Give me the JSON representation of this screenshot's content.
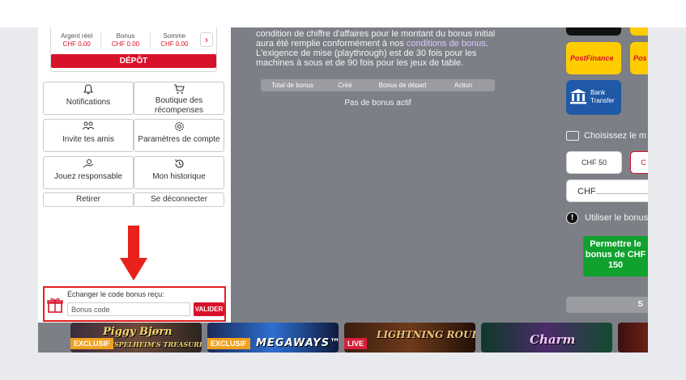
{
  "balance": {
    "cols": [
      {
        "label": "Argent réel",
        "value": "CHF 0.00"
      },
      {
        "label": "Bonus",
        "value": "CHF 0.00"
      },
      {
        "label": "Somme",
        "value": "CHF 0.00"
      }
    ],
    "arrow": "›",
    "deposit_label": "DÉPÔT"
  },
  "menu": {
    "notifications": "Notifications",
    "shop": "Boutique des récompenses",
    "invite": "Invite tes amis",
    "settings": "Paramètres de compte",
    "responsible": "Jouez responsable",
    "history": "Mon historique",
    "withdraw": "Retirer",
    "logout": "Se déconnecter"
  },
  "bonus_code": {
    "label": "Échanger le code bonus reçu:",
    "placeholder": "Bonus code",
    "submit_label": "VALIDER"
  },
  "main": {
    "text_before_link": "condition de chiffre d'affaires pour le montant du bonus initial aura été remplie conformément à nos ",
    "link_text": "conditions de bonus",
    "text_after_link": ". L'exigence de mise (playthrough) est de 30 fois pour les machines à sous et de 90 fois pour les jeux de table.",
    "table_headers": [
      "Total de bonus",
      "Créé",
      "Bonus de départ",
      "Action"
    ],
    "empty_message": "Pas de bonus actif"
  },
  "payment": {
    "postfinance": "PostFinance",
    "postfinance_partial": "Pos",
    "bank_line1": "Bank",
    "bank_line2": "Transfer",
    "choose_label": "Choisissez le m",
    "amount_1": "CHF 50",
    "amount_2_partial": "C",
    "currency_label": "CHF",
    "use_bonus_label": "Utiliser le bonus",
    "allow_bonus_button": "Permettre le bonus de CHF 150",
    "submit_partial": "S"
  },
  "games": [
    {
      "badge": "EXCLUSIF",
      "title": "Piggy Bjørn",
      "subtitle": "MUSPELHEIM'S TREASURE"
    },
    {
      "badge": "EXCLUSIF",
      "title": "MEGAWAYS™"
    },
    {
      "badge": "LIVE",
      "title": "LIGHTNING ROULETTE"
    },
    {
      "title": "Charm"
    },
    {}
  ],
  "colors": {
    "brand_red": "#d8112a",
    "green": "#10a12e",
    "postfinance_yellow": "#ffcc00",
    "bank_blue": "#1f59a7"
  }
}
